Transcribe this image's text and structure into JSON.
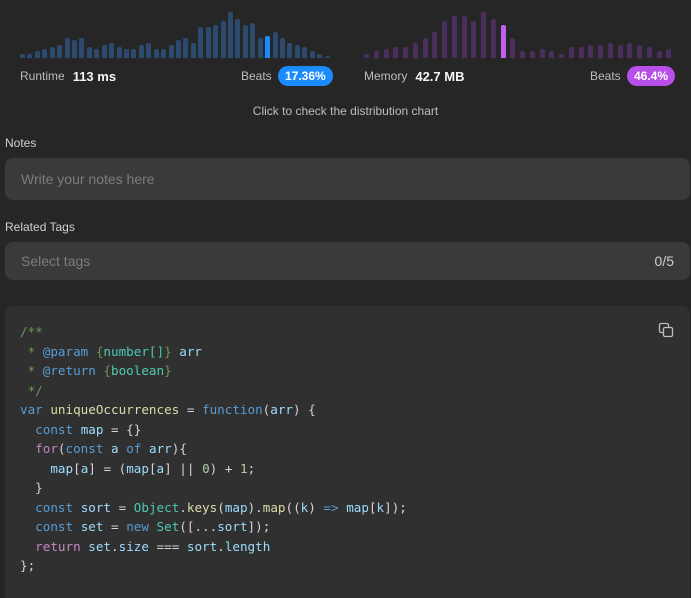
{
  "runtime": {
    "label": "Runtime",
    "value": "113 ms",
    "beats_label": "Beats",
    "beats_value": "17.36%",
    "histogram": [
      2,
      2,
      3,
      4,
      5,
      6,
      9,
      8,
      9,
      5,
      4,
      6,
      7,
      5,
      4,
      4,
      6,
      7,
      4,
      4,
      6,
      8,
      9,
      7,
      14,
      14,
      15,
      17,
      21,
      18,
      15,
      16,
      9,
      10,
      12,
      9,
      7,
      6,
      5,
      3,
      2,
      1
    ],
    "highlight_index": 33,
    "bar_color": "#2c4a6e",
    "highlight_color": "#1a8cff"
  },
  "memory": {
    "label": "Memory",
    "value": "42.7 MB",
    "beats_label": "Beats",
    "beats_value": "46.4%",
    "histogram": [
      2,
      3,
      4,
      5,
      5,
      7,
      9,
      12,
      17,
      19,
      19,
      17,
      21,
      18,
      15,
      9,
      3,
      3,
      4,
      3,
      2,
      5,
      5,
      6,
      6,
      7,
      6,
      7,
      6,
      5,
      3,
      4
    ],
    "highlight_index": 14,
    "bar_color": "#4a2e5e",
    "highlight_color": "#c060f0"
  },
  "distribution_hint": "Click to check the distribution chart",
  "notes": {
    "label": "Notes",
    "placeholder": "Write your notes here"
  },
  "tags": {
    "label": "Related Tags",
    "placeholder": "Select tags",
    "count": "0/5"
  },
  "code": {
    "copy_icon": "copy-icon",
    "lines": [
      [
        [
          "/**",
          "comment"
        ]
      ],
      [
        [
          " * ",
          "comment"
        ],
        [
          "@param",
          "doctag"
        ],
        [
          " {",
          "comment"
        ],
        [
          "number[]",
          "type"
        ],
        [
          "} ",
          "comment"
        ],
        [
          "arr",
          "var"
        ]
      ],
      [
        [
          " * ",
          "comment"
        ],
        [
          "@return",
          "doctag"
        ],
        [
          " {",
          "comment"
        ],
        [
          "boolean",
          "type"
        ],
        [
          "}",
          "comment"
        ]
      ],
      [
        [
          " */",
          "comment"
        ]
      ],
      [
        [
          "var",
          "kw"
        ],
        [
          " ",
          ""
        ],
        [
          "uniqueOccurrences",
          "fn"
        ],
        [
          " = ",
          ""
        ],
        [
          "function",
          "kw"
        ],
        [
          "(",
          ""
        ],
        [
          "arr",
          "var"
        ],
        [
          ") {",
          ""
        ]
      ],
      [
        [
          "  ",
          ""
        ],
        [
          "const",
          "kw"
        ],
        [
          " ",
          ""
        ],
        [
          "map",
          "var"
        ],
        [
          " = {}",
          ""
        ]
      ],
      [
        [
          "  ",
          ""
        ],
        [
          "for",
          "ctrl"
        ],
        [
          "(",
          ""
        ],
        [
          "const",
          "kw"
        ],
        [
          " ",
          ""
        ],
        [
          "a",
          "var"
        ],
        [
          " ",
          ""
        ],
        [
          "of",
          "kw"
        ],
        [
          " ",
          ""
        ],
        [
          "arr",
          "var"
        ],
        [
          "){",
          ""
        ]
      ],
      [
        [
          "    ",
          ""
        ],
        [
          "map",
          "var"
        ],
        [
          "[",
          ""
        ],
        [
          "a",
          "var"
        ],
        [
          "] = (",
          ""
        ],
        [
          "map",
          "var"
        ],
        [
          "[",
          ""
        ],
        [
          "a",
          "var"
        ],
        [
          "] || ",
          ""
        ],
        [
          "0",
          "num"
        ],
        [
          ") + ",
          ""
        ],
        [
          "1",
          "num"
        ],
        [
          ";",
          ""
        ]
      ],
      [
        [
          "  }",
          ""
        ]
      ],
      [
        [
          "  ",
          ""
        ],
        [
          "const",
          "kw"
        ],
        [
          " ",
          ""
        ],
        [
          "sort",
          "var"
        ],
        [
          " = ",
          ""
        ],
        [
          "Object",
          "cls"
        ],
        [
          ".",
          ""
        ],
        [
          "keys",
          "fn"
        ],
        [
          "(",
          ""
        ],
        [
          "map",
          "var"
        ],
        [
          ").",
          ""
        ],
        [
          "map",
          "fn"
        ],
        [
          "((",
          ""
        ],
        [
          "k",
          "var"
        ],
        [
          ") ",
          ""
        ],
        [
          "=>",
          "kw"
        ],
        [
          " ",
          ""
        ],
        [
          "map",
          "var"
        ],
        [
          "[",
          ""
        ],
        [
          "k",
          "var"
        ],
        [
          "]);",
          ""
        ]
      ],
      [
        [
          "  ",
          ""
        ],
        [
          "const",
          "kw"
        ],
        [
          " ",
          ""
        ],
        [
          "set",
          "var"
        ],
        [
          " = ",
          ""
        ],
        [
          "new",
          "kw"
        ],
        [
          " ",
          ""
        ],
        [
          "Set",
          "cls"
        ],
        [
          "([...",
          ""
        ],
        [
          "sort",
          "var"
        ],
        [
          "]);",
          ""
        ]
      ],
      [
        [
          "  ",
          ""
        ],
        [
          "return",
          "ctrl"
        ],
        [
          " ",
          ""
        ],
        [
          "set",
          "var"
        ],
        [
          ".",
          ""
        ],
        [
          "size",
          "var"
        ],
        [
          " === ",
          ""
        ],
        [
          "sort",
          "var"
        ],
        [
          ".",
          ""
        ],
        [
          "length",
          "var"
        ]
      ],
      [
        [
          "};",
          ""
        ]
      ]
    ]
  }
}
